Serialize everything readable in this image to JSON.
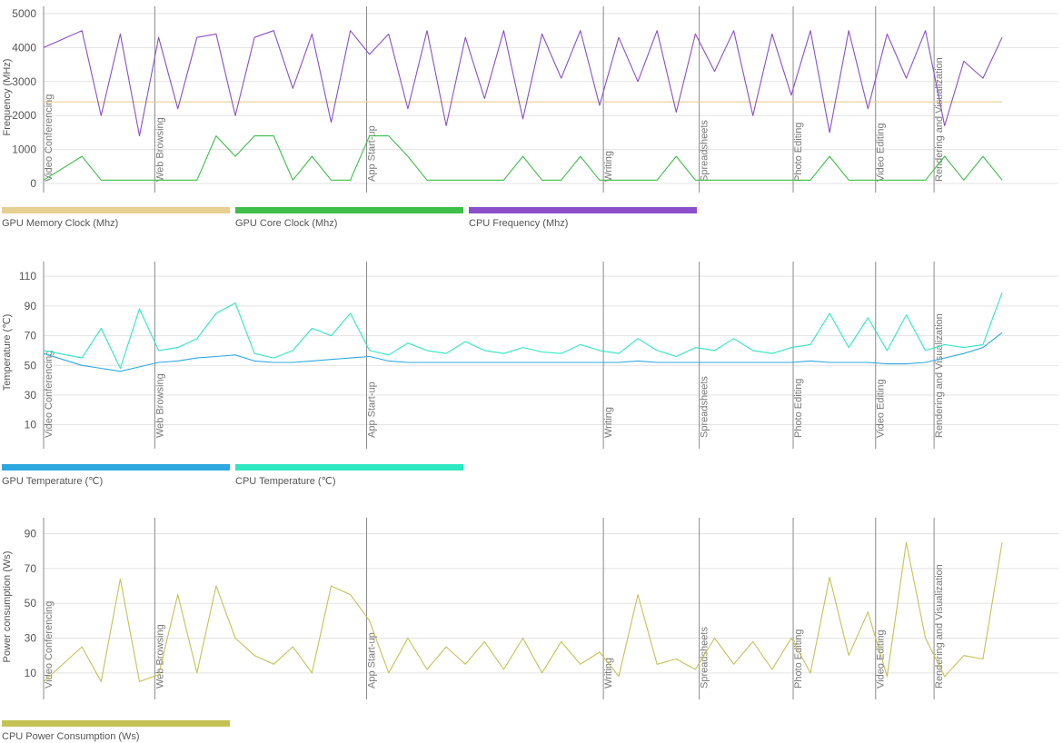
{
  "chart_data": [
    {
      "type": "line",
      "ylabel": "Frequency (MHz)",
      "yticks": [
        0,
        1000,
        2000,
        3000,
        4000,
        5000
      ],
      "ylim": [
        0,
        5000
      ],
      "x": [
        0,
        4,
        6,
        8,
        10,
        12,
        14,
        16,
        18,
        20,
        22,
        24,
        26,
        28,
        30,
        32,
        34,
        36,
        38,
        40,
        42,
        44,
        46,
        48,
        50,
        52,
        54,
        56,
        58,
        60,
        62,
        64,
        66,
        68,
        70,
        72,
        74,
        76,
        78,
        80,
        82,
        84,
        86,
        88,
        90,
        92,
        94,
        96,
        98,
        100
      ],
      "segments": [
        {
          "label": "Video Conferencing",
          "start": 0
        },
        {
          "label": "Web Browsing",
          "start": 11.6
        },
        {
          "label": "App Start-up",
          "start": 33.7
        },
        {
          "label": "Writing",
          "start": 58.4
        },
        {
          "label": "Spreadsheets",
          "start": 68.4
        },
        {
          "label": "Photo Editing",
          "start": 78.2
        },
        {
          "label": "Video Editing",
          "start": 86.8
        },
        {
          "label": "Rendering and Visualization",
          "start": 92.9
        }
      ],
      "series": [
        {
          "name": "GPU Memory Clock (Mhz)",
          "color": "#e6cf93",
          "values": [
            2400,
            2400,
            2400,
            2400,
            2400,
            2400,
            2400,
            2400,
            2400,
            2400,
            2400,
            2400,
            2400,
            2400,
            2400,
            2400,
            2400,
            2400,
            2400,
            2400,
            2400,
            2400,
            2400,
            2400,
            2400,
            2400,
            2400,
            2400,
            2400,
            2400,
            2400,
            2400,
            2400,
            2400,
            2400,
            2400,
            2400,
            2400,
            2400,
            2400,
            2400,
            2400,
            2400,
            2400,
            2400,
            2400,
            2400,
            2400,
            2400,
            2400
          ]
        },
        {
          "name": "GPU Core Clock (Mhz)",
          "color": "#3dbf4a",
          "values": [
            100,
            800,
            100,
            100,
            100,
            100,
            100,
            100,
            1400,
            800,
            1400,
            1400,
            100,
            800,
            100,
            100,
            1400,
            1400,
            800,
            100,
            100,
            100,
            100,
            100,
            800,
            100,
            100,
            800,
            100,
            100,
            100,
            100,
            800,
            100,
            100,
            100,
            100,
            100,
            100,
            100,
            800,
            100,
            100,
            100,
            100,
            100,
            800,
            100,
            800,
            100
          ]
        },
        {
          "name": "CPU Frequency (Mhz)",
          "color": "#8b4fc9",
          "values": [
            4000,
            4500,
            2000,
            4400,
            1400,
            4300,
            2200,
            4300,
            4400,
            2000,
            4300,
            4500,
            2800,
            4400,
            1800,
            4500,
            3800,
            4400,
            2200,
            4500,
            1700,
            4300,
            2500,
            4500,
            1900,
            4400,
            3100,
            4500,
            2300,
            4300,
            3000,
            4500,
            2100,
            4400,
            3300,
            4500,
            2000,
            4400,
            2600,
            4500,
            1500,
            4500,
            2200,
            4400,
            3100,
            4500,
            1700,
            3600,
            3100,
            4300
          ]
        }
      ]
    },
    {
      "type": "line",
      "ylabel": "Temperature (℃)",
      "yticks": [
        10,
        30,
        50,
        70,
        90,
        110
      ],
      "ylim": [
        0,
        115
      ],
      "x": [
        0,
        4,
        6,
        8,
        10,
        12,
        14,
        16,
        18,
        20,
        22,
        24,
        26,
        28,
        30,
        32,
        34,
        36,
        38,
        40,
        42,
        44,
        46,
        48,
        50,
        52,
        54,
        56,
        58,
        60,
        62,
        64,
        66,
        68,
        70,
        72,
        74,
        76,
        78,
        80,
        82,
        84,
        86,
        88,
        90,
        92,
        94,
        96,
        98,
        100
      ],
      "segments": [
        {
          "label": "Video Conferencing",
          "start": 0
        },
        {
          "label": "Web Browsing",
          "start": 11.6
        },
        {
          "label": "App Start-up",
          "start": 33.7
        },
        {
          "label": "Writing",
          "start": 58.4
        },
        {
          "label": "Spreadsheets",
          "start": 68.4
        },
        {
          "label": "Photo Editing",
          "start": 78.2
        },
        {
          "label": "Video Editing",
          "start": 86.8
        },
        {
          "label": "Rendering and Visualization",
          "start": 92.9
        }
      ],
      "series": [
        {
          "name": "GPU Temperature (℃)",
          "color": "#2ea8e0",
          "values": [
            58,
            50,
            48,
            46,
            49,
            52,
            53,
            55,
            56,
            57,
            53,
            52,
            52,
            53,
            54,
            55,
            56,
            53,
            52,
            52,
            52,
            52,
            52,
            52,
            52,
            52,
            52,
            52,
            52,
            52,
            53,
            52,
            52,
            52,
            52,
            52,
            52,
            52,
            52,
            53,
            52,
            52,
            52,
            51,
            51,
            52,
            55,
            58,
            62,
            72
          ]
        },
        {
          "name": "CPU Temperature (℃)",
          "color": "#2de8c0",
          "values": [
            60,
            55,
            75,
            48,
            88,
            60,
            62,
            68,
            85,
            92,
            58,
            55,
            60,
            75,
            70,
            85,
            60,
            57,
            65,
            60,
            58,
            66,
            60,
            58,
            62,
            59,
            58,
            64,
            60,
            58,
            68,
            60,
            56,
            62,
            60,
            68,
            60,
            58,
            62,
            64,
            85,
            62,
            82,
            60,
            84,
            60,
            64,
            62,
            64,
            99
          ]
        }
      ]
    },
    {
      "type": "line",
      "ylabel": "Power consumption (Ws)",
      "yticks": [
        10,
        30,
        50,
        70,
        90
      ],
      "ylim": [
        0,
        95
      ],
      "x": [
        0,
        4,
        6,
        8,
        10,
        12,
        14,
        16,
        18,
        20,
        22,
        24,
        26,
        28,
        30,
        32,
        34,
        36,
        38,
        40,
        42,
        44,
        46,
        48,
        50,
        52,
        54,
        56,
        58,
        60,
        62,
        64,
        66,
        68,
        70,
        72,
        74,
        76,
        78,
        80,
        82,
        84,
        86,
        88,
        90,
        92,
        94,
        96,
        98,
        100
      ],
      "segments": [
        {
          "label": "Video Conferencing",
          "start": 0
        },
        {
          "label": "Web Browsing",
          "start": 11.6
        },
        {
          "label": "App Start-up",
          "start": 33.7
        },
        {
          "label": "Writing",
          "start": 58.4
        },
        {
          "label": "Spreadsheets",
          "start": 68.4
        },
        {
          "label": "Photo Editing",
          "start": 78.2
        },
        {
          "label": "Video Editing",
          "start": 86.8
        },
        {
          "label": "Rendering and Visualization",
          "start": 92.9
        }
      ],
      "series": [
        {
          "name": "CPU Power Consumption (Ws)",
          "color": "#c4c254",
          "values": [
            5,
            25,
            5,
            64,
            5,
            9,
            55,
            10,
            60,
            30,
            20,
            15,
            25,
            10,
            60,
            55,
            40,
            10,
            30,
            12,
            25,
            15,
            28,
            12,
            30,
            10,
            28,
            15,
            22,
            8,
            55,
            15,
            18,
            12,
            30,
            15,
            28,
            12,
            30,
            10,
            65,
            20,
            45,
            8,
            85,
            30,
            8,
            20,
            18,
            85
          ]
        }
      ]
    }
  ]
}
